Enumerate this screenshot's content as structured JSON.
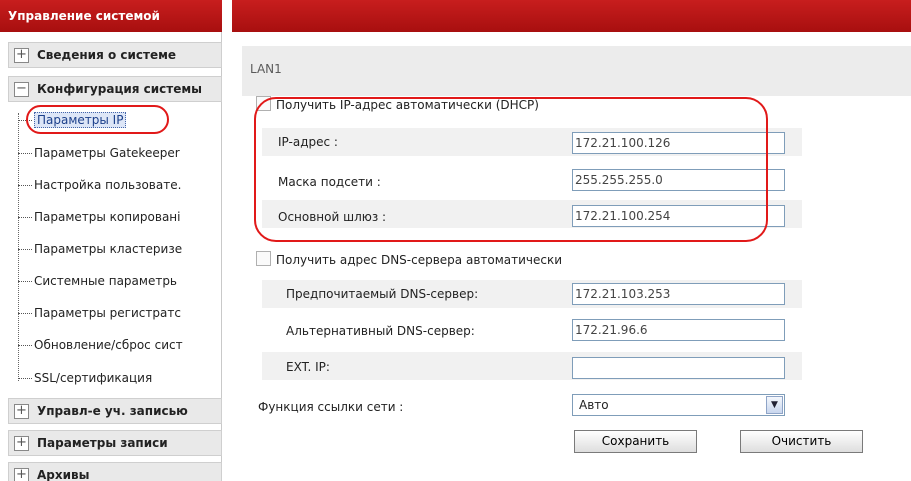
{
  "sidebar": {
    "title": "Управление системой",
    "groups": [
      {
        "sign": "+",
        "label": "Сведения о системе"
      },
      {
        "sign": "−",
        "label": "Конфигурация системы"
      },
      {
        "sign": "+",
        "label": "Управл-е уч. записью"
      },
      {
        "sign": "+",
        "label": "Параметры записи"
      },
      {
        "sign": "+",
        "label": "Архивы"
      }
    ],
    "items": [
      {
        "label": "Параметры IP",
        "selected": true
      },
      {
        "label": "Параметры Gatekeeper"
      },
      {
        "label": "Настройка пользовате."
      },
      {
        "label": "Параметры копировані"
      },
      {
        "label": "Параметры кластеризе"
      },
      {
        "label": "Системные параметрь"
      },
      {
        "label": "Параметры регистратс"
      },
      {
        "label": "Обновление/сброс сист"
      },
      {
        "label": "SSL/сертификация"
      }
    ]
  },
  "main": {
    "section_title": "LAN1",
    "dhcp_label": "Получить IP-адрес автоматически (DHCP)",
    "ip": {
      "label": "IP-адрес :",
      "value": "172.21.100.126"
    },
    "mask": {
      "label": "Маска подсети :",
      "value": "255.255.255.0"
    },
    "gateway": {
      "label": "Основной шлюз :",
      "value": "172.21.100.254"
    },
    "dns_auto_label": "Получить адрес DNS-сервера автоматически",
    "dns_pref": {
      "label": "Предпочитаемый DNS-сервер:",
      "value": "172.21.103.253"
    },
    "dns_alt": {
      "label": "Альтернативный DNS-сервер:",
      "value": "172.21.96.6"
    },
    "ext_ip": {
      "label": "EXT. IP:",
      "value": ""
    },
    "link_func": {
      "label": "Функция ссылки сети :",
      "value": "Авто"
    },
    "save_label": "Сохранить",
    "clear_label": "Очистить"
  },
  "colors": {
    "header_red": "#b51515",
    "annotation_red": "#e11919"
  }
}
